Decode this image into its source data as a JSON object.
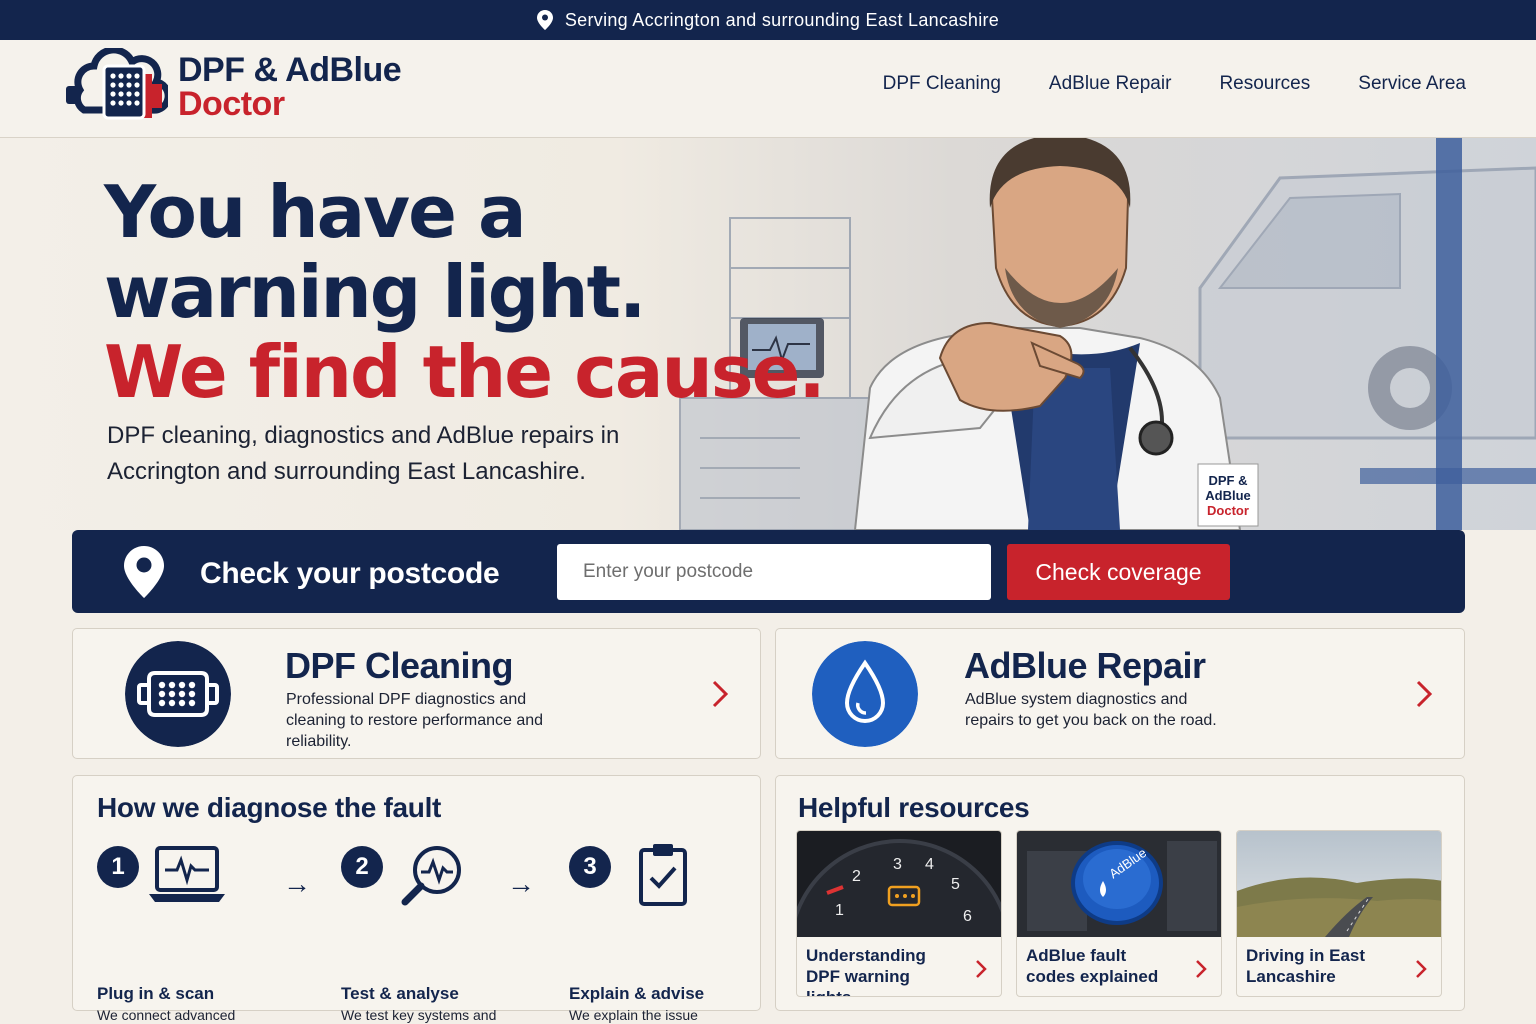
{
  "topbar": {
    "text": "Serving Accrington and surrounding East Lancashire"
  },
  "logo": {
    "line1": "DPF & AdBlue",
    "line2": "Doctor"
  },
  "nav": [
    "DPF Cleaning",
    "AdBlue Repair",
    "Resources",
    "Service Area"
  ],
  "hero": {
    "title_line1": "You have a",
    "title_line2": "warning light.",
    "title_line3": "We find the cause.",
    "subtitle": "DPF cleaning, diagnostics and AdBlue repairs in Accrington and surrounding East Lancashire.",
    "badge_line1": "DPF &",
    "badge_line2": "AdBlue",
    "badge_line3": "Doctor"
  },
  "postcode": {
    "label": "Check your postcode",
    "placeholder": "Enter your postcode",
    "button": "Check coverage"
  },
  "services": [
    {
      "title": "DPF Cleaning",
      "description": "Professional DPF diagnostics and cleaning to restore performance and reliability."
    },
    {
      "title": "AdBlue Repair",
      "description": "AdBlue system diagnostics and repairs to get you back on the road."
    }
  ],
  "diagnose": {
    "title": "How we diagnose the fault",
    "steps": [
      {
        "num": "1",
        "title": "Plug in & scan",
        "description": "We connect advanced diagnostic equipment to read fault codes."
      },
      {
        "num": "2",
        "title": "Test & analyse",
        "description": "We test key systems and identify the root cause."
      },
      {
        "num": "3",
        "title": "Explain & advise",
        "description": "We explain the issue clearly and recommend the right fix."
      }
    ]
  },
  "resources": {
    "title": "Helpful resources",
    "items": [
      {
        "label": "Understanding DPF warning lights"
      },
      {
        "label": "AdBlue fault codes explained"
      },
      {
        "label": "Driving in East Lancashire"
      }
    ],
    "gauge_ticks": [
      "1",
      "2",
      "3",
      "4",
      "5",
      "6"
    ],
    "cap_text": "AdBlue"
  },
  "colors": {
    "navy": "#13254d",
    "red": "#c8232c",
    "blue": "#1f5fbf",
    "cream": "#f3efe8"
  }
}
